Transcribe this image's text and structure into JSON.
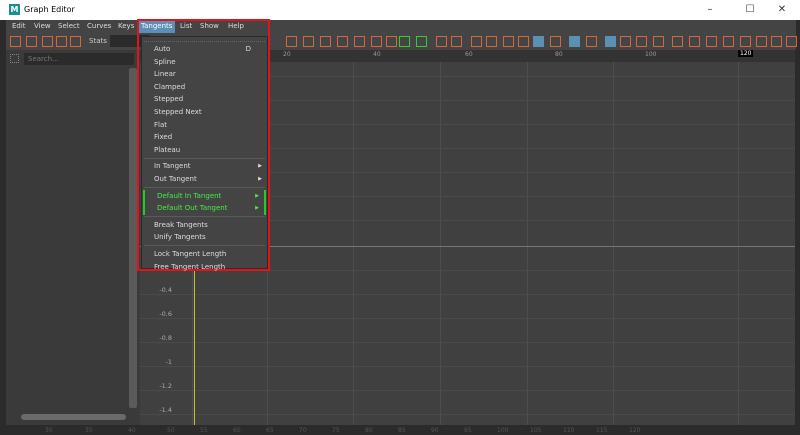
{
  "window": {
    "title": "Graph Editor",
    "logo": "M",
    "minimize": "–",
    "maximize": "☐",
    "close": "✕"
  },
  "menubar": [
    "Edit",
    "View",
    "Select",
    "Curves",
    "Keys",
    "Tangents",
    "List",
    "Show",
    "Help"
  ],
  "toolbar": {
    "stats_label": "Stats"
  },
  "outliner": {
    "search_placeholder": "Search..."
  },
  "ruler": {
    "labels": [
      "20",
      "40",
      "60",
      "80",
      "100"
    ],
    "current_frame": "120"
  },
  "yaxis": [
    "-0.4",
    "-0.6",
    "-0.8",
    "-1",
    "-1.2",
    "-1.4"
  ],
  "timeslider": [
    "30",
    "35",
    "40",
    "45",
    "50",
    "55",
    "60",
    "65",
    "70",
    "75",
    "80",
    "85",
    "90",
    "95",
    "100",
    "105",
    "110",
    "115",
    "120"
  ],
  "tangents_menu": {
    "group1": [
      {
        "label": "Auto",
        "shortcut": "D"
      },
      {
        "label": "Spline"
      },
      {
        "label": "Linear"
      },
      {
        "label": "Clamped"
      },
      {
        "label": "Stepped"
      },
      {
        "label": "Stepped Next"
      },
      {
        "label": "Flat"
      },
      {
        "label": "Fixed"
      },
      {
        "label": "Plateau"
      }
    ],
    "group2": [
      "In Tangent",
      "Out Tangent"
    ],
    "group3": [
      "Default In Tangent",
      "Default Out Tangent"
    ],
    "group4": [
      "Break Tangents",
      "Unify Tangents"
    ],
    "group5": [
      "Lock Tangent Length",
      "Free Tangent Length"
    ]
  }
}
